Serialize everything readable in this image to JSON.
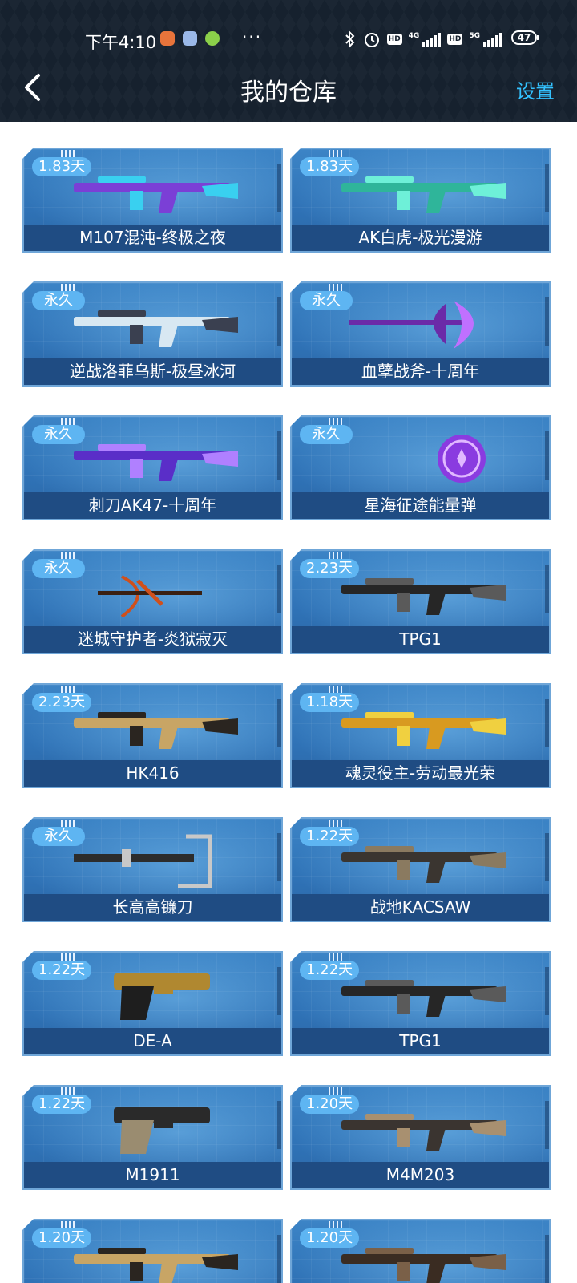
{
  "status_bar": {
    "time": "下午4:10",
    "dots": "···",
    "network_1": "4G",
    "network_2": "5G",
    "hd": "HD",
    "battery": "47"
  },
  "nav": {
    "title": "我的仓库",
    "settings": "设置"
  },
  "items": [
    {
      "duration": "1.83天",
      "name": "M107混沌-终极之夜",
      "icon": "sniper-rifle-purple"
    },
    {
      "duration": "1.83天",
      "name": "AK白虎-极光漫游",
      "icon": "assault-rifle-aurora"
    },
    {
      "duration": "永久",
      "name": "逆战洛菲乌斯-极昼冰河",
      "icon": "chainsaw-ice"
    },
    {
      "duration": "永久",
      "name": "血孽战斧-十周年",
      "icon": "battle-axe-purple"
    },
    {
      "duration": "永久",
      "name": "刺刀AK47-十周年",
      "icon": "bayonet-ak-purple"
    },
    {
      "duration": "永久",
      "name": "星海征途能量弹",
      "icon": "energy-orb-purple"
    },
    {
      "duration": "永久",
      "name": "迷城守护者-炎狱寂灭",
      "icon": "crossbow-orange"
    },
    {
      "duration": "2.23天",
      "name": "TPG1",
      "icon": "sniper-rifle-black"
    },
    {
      "duration": "2.23天",
      "name": "HK416",
      "icon": "assault-rifle-gold"
    },
    {
      "duration": "1.18天",
      "name": "魂灵役主-劳动最光荣",
      "icon": "heavy-gun-gold"
    },
    {
      "duration": "永久",
      "name": "长高高镰刀",
      "icon": "scythe-tool"
    },
    {
      "duration": "1.22天",
      "name": "战地KACSAW",
      "icon": "machine-gun-camo"
    },
    {
      "duration": "1.22天",
      "name": "DE-A",
      "icon": "pistol-gold"
    },
    {
      "duration": "1.22天",
      "name": "TPG1",
      "icon": "sniper-rifle-black"
    },
    {
      "duration": "1.22天",
      "name": "M1911",
      "icon": "pistol-camo"
    },
    {
      "duration": "1.20天",
      "name": "M4M203",
      "icon": "rifle-launcher-tan"
    },
    {
      "duration": "1.20天",
      "name": "",
      "icon": "assault-rifle-gold"
    },
    {
      "duration": "1.20天",
      "name": "",
      "icon": "smg-brown"
    }
  ],
  "colors": {
    "header_bg": "#16212e",
    "accent": "#33c2ff",
    "card": "#3478ba",
    "badge": "#5eb5f2",
    "name_bar": "#1f4c83"
  }
}
